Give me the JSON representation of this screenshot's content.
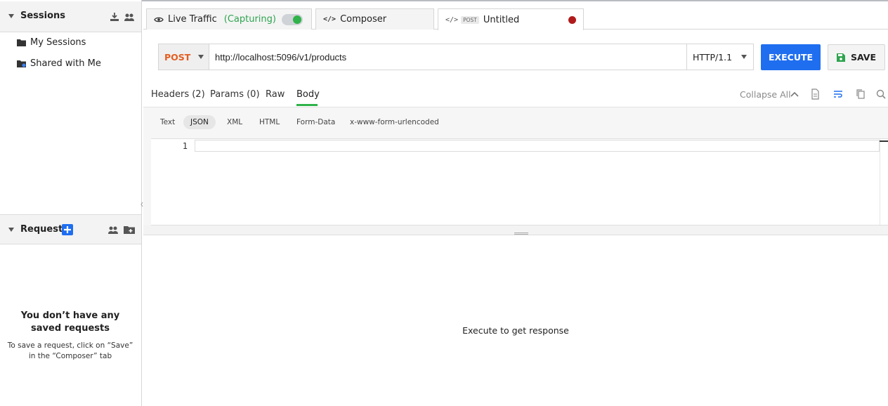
{
  "sidebar": {
    "sessions": {
      "title": "Sessions",
      "items": [
        {
          "label": "My Sessions",
          "icon": "folder-icon"
        },
        {
          "label": "Shared with Me",
          "icon": "shared-folder-icon"
        }
      ]
    },
    "requests": {
      "title": "Requests",
      "empty_title": "You don’t have any saved requests",
      "empty_hint": "To save a request, click on “Save” in the “Composer” tab"
    }
  },
  "tabs": {
    "live_traffic": {
      "label": "Live Traffic",
      "status": "(Capturing)",
      "toggle_on": true
    },
    "composer": {
      "label": "Composer"
    },
    "untitled": {
      "method_badge": "POST",
      "label": "Untitled"
    }
  },
  "request": {
    "method": "POST",
    "url": "http://localhost:5096/v1/products",
    "protocol": "HTTP/1.1",
    "execute_label": "EXECUTE",
    "save_label": "SAVE"
  },
  "subtabs": {
    "headers": "Headers (2)",
    "params": "Params (0)",
    "raw": "Raw",
    "body": "Body",
    "collapse_all": "Collapse All"
  },
  "body_types": [
    "Text",
    "JSON",
    "XML",
    "HTML",
    "Form-Data",
    "x-www-form-urlencoded"
  ],
  "editor": {
    "line_number": "1"
  },
  "response": {
    "message": "Execute to get response"
  },
  "colors": {
    "accent": "#1f6ef0",
    "capturing": "#2ea44f",
    "method": "#e45d20",
    "unsaved": "#b11b1b"
  }
}
